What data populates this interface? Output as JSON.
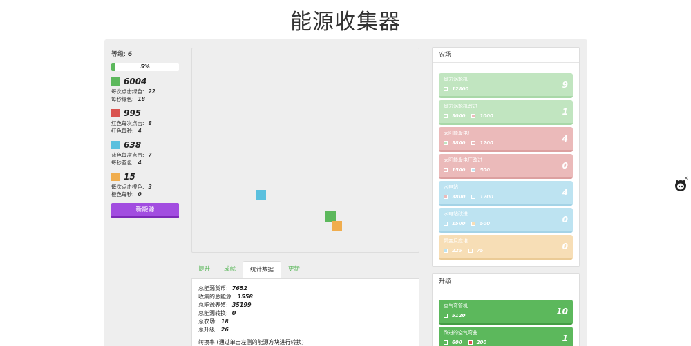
{
  "title": "能源收集器",
  "level": {
    "label": "等级:",
    "value": "6"
  },
  "progress": {
    "text": "5%",
    "fraction": 0.05
  },
  "resources": [
    {
      "color": "#5cb85c",
      "amount": "6004",
      "line1_label": "每次点击绿色:",
      "line1_value": "22",
      "line2_label": "每秒绿色:",
      "line2_value": "18"
    },
    {
      "color": "#d9534f",
      "amount": "995",
      "line1_label": "红色每次点击:",
      "line1_value": "8",
      "line2_label": "红色每秒:",
      "line2_value": "4"
    },
    {
      "color": "#5bc0de",
      "amount": "638",
      "line1_label": "蓝色每次点击:",
      "line1_value": "7",
      "line2_label": "每秒蓝色:",
      "line2_value": "4"
    },
    {
      "color": "#f0ad4e",
      "amount": "15",
      "line1_label": "每次点击橙色:",
      "line1_value": "3",
      "line2_label": "橙色每秒:",
      "line2_value": "0"
    }
  ],
  "new_energy_button": "新能源",
  "game_blocks": [
    {
      "color": "#5bc0de",
      "name": "blue-energy-block"
    },
    {
      "color": "#5cb85c",
      "name": "green-energy-block"
    },
    {
      "color": "#f0ad4e",
      "name": "orange-energy-block"
    }
  ],
  "tabs": [
    {
      "label": "提升",
      "active": false
    },
    {
      "label": "成就",
      "active": false
    },
    {
      "label": "统计数据",
      "active": true
    },
    {
      "label": "更新",
      "active": false
    }
  ],
  "stats": [
    {
      "label": "总能源货币:",
      "value": "7652"
    },
    {
      "label": "收集的总能源:",
      "value": "1558"
    },
    {
      "label": "总能源养殖:",
      "value": "35199"
    },
    {
      "label": "总能源转换:",
      "value": "0"
    },
    {
      "label": "总农场:",
      "value": "18"
    },
    {
      "label": "总升级:",
      "value": "26"
    }
  ],
  "conversion_note": "转换率 (通过单击左侧的能源方块进行转换)",
  "farm_panel": {
    "title": "农场",
    "items": [
      {
        "name": "风力涡轮机",
        "count": "9",
        "style": "green-l",
        "costs": [
          {
            "icon_color": "#c1e5c0",
            "value": "12800"
          }
        ]
      },
      {
        "name": "风力涡轮机改进",
        "count": "1",
        "style": "green-l",
        "costs": [
          {
            "icon_color": "#c1e5c0",
            "value": "3000"
          },
          {
            "icon_color": "#ebbaba",
            "value": "1000"
          }
        ]
      },
      {
        "name": "太阳能发电厂",
        "count": "4",
        "style": "red-l",
        "costs": [
          {
            "icon_color": "#c1e5c0",
            "value": "3800"
          },
          {
            "icon_color": "#ebbaba",
            "value": "1200"
          }
        ]
      },
      {
        "name": "太阳能发电厂改进",
        "count": "0",
        "style": "red-l",
        "costs": [
          {
            "icon_color": "#ebbaba",
            "value": "1500"
          },
          {
            "icon_color": "#bde3f1",
            "value": "500"
          }
        ]
      },
      {
        "name": "水电站",
        "count": "4",
        "style": "blue-l",
        "costs": [
          {
            "icon_color": "#ebbaba",
            "value": "3800"
          },
          {
            "icon_color": "#bde3f1",
            "value": "1200"
          }
        ]
      },
      {
        "name": "水电站改进",
        "count": "0",
        "style": "blue-l",
        "costs": [
          {
            "icon_color": "#bde3f1",
            "value": "1500"
          },
          {
            "icon_color": "#f7deb6",
            "value": "500"
          }
        ]
      },
      {
        "name": "聚变反应堆",
        "count": "0",
        "style": "orange-l",
        "costs": [
          {
            "icon_color": "#bde3f1",
            "value": "225"
          },
          {
            "icon_color": "#f7deb6",
            "value": "75"
          }
        ]
      }
    ]
  },
  "upgrade_panel": {
    "title": "升级",
    "items": [
      {
        "name": "空气弯管机",
        "count": "10",
        "style": "green",
        "costs": [
          {
            "icon_color": "#5cb85c",
            "value": "5120"
          }
        ]
      },
      {
        "name": "改进的空气弯曲",
        "count": "1",
        "style": "green",
        "costs": [
          {
            "icon_color": "#5cb85c",
            "value": "600"
          },
          {
            "icon_color": "#d9534f",
            "value": "200"
          }
        ]
      }
    ]
  },
  "side_icon": "github-octocat-icon"
}
